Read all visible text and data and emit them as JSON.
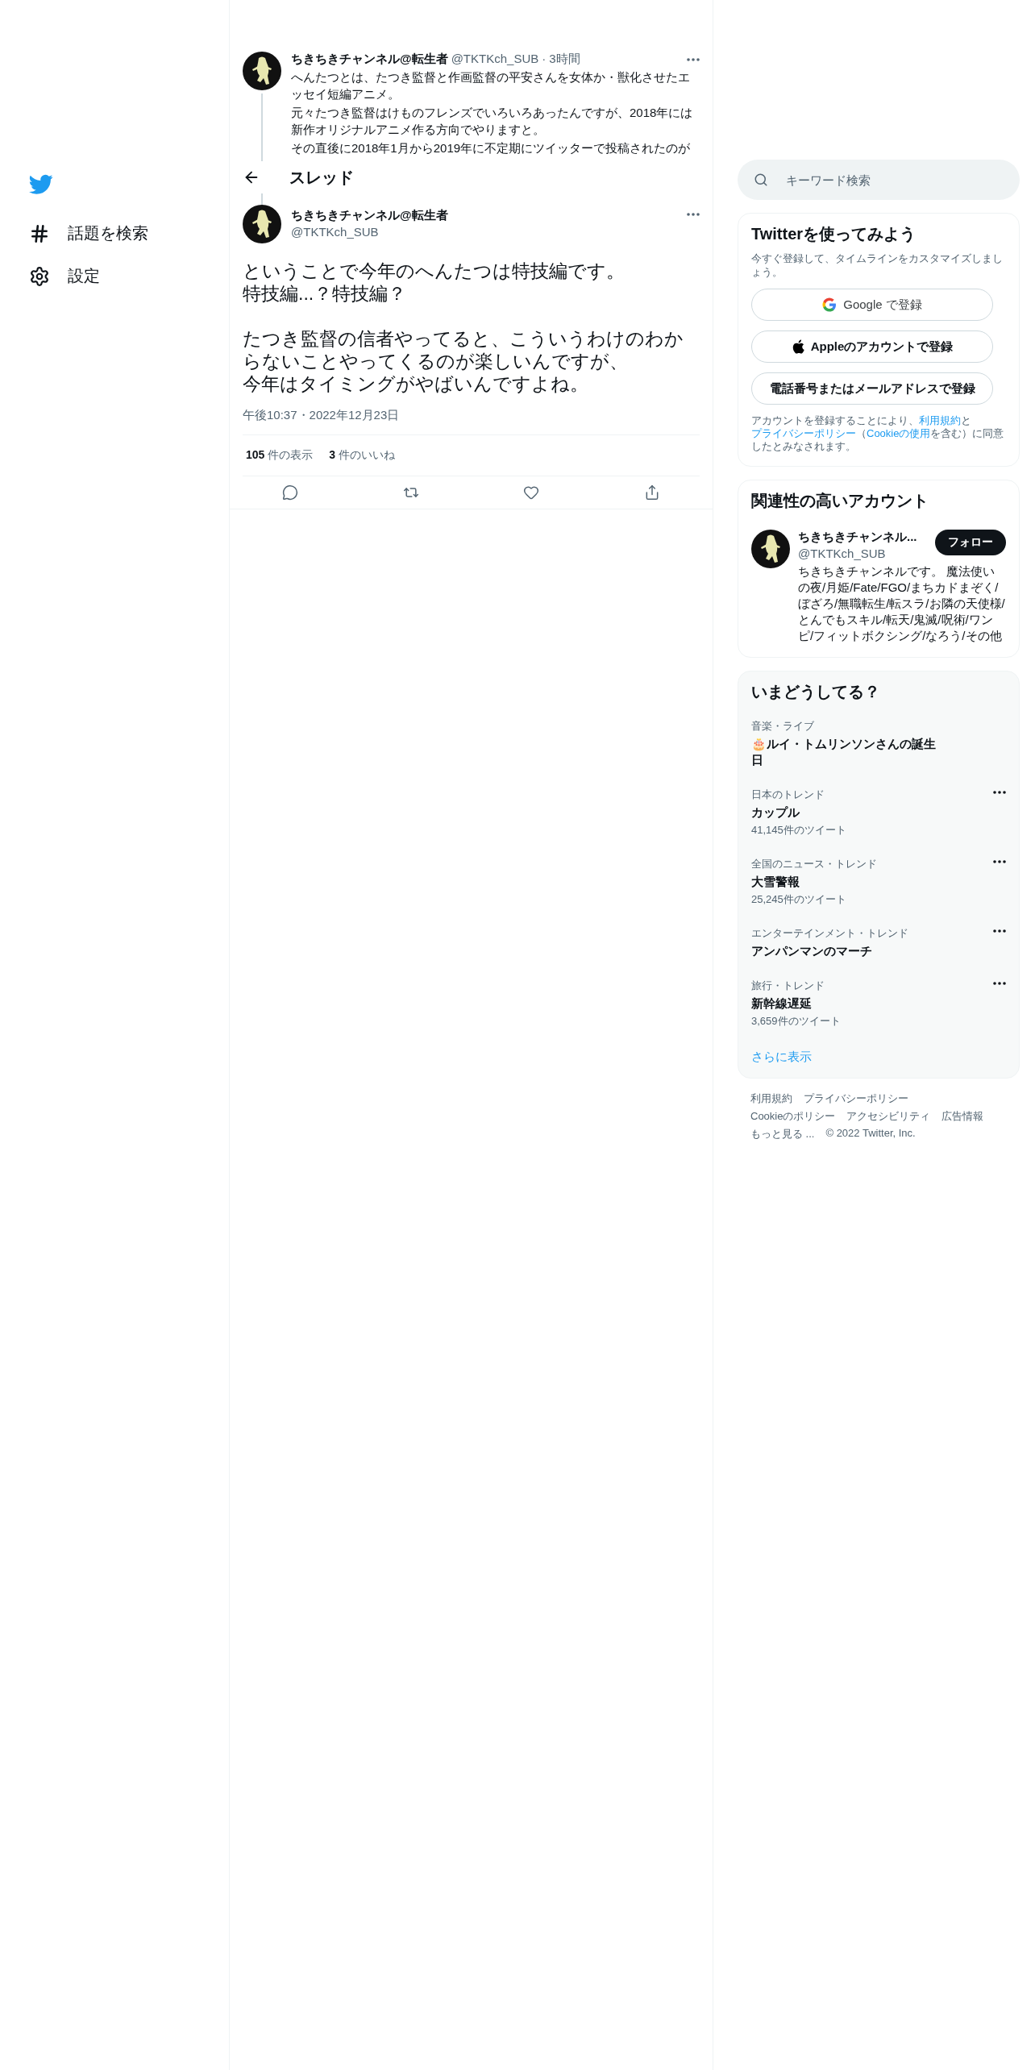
{
  "sidebar": {
    "items": [
      {
        "kind": "logo"
      },
      {
        "kind": "hashtag",
        "label": "話題を検索"
      },
      {
        "kind": "settings",
        "label": "設定"
      }
    ]
  },
  "parent_tweet": {
    "name": "ちきちきチャンネル@転生者",
    "handle": "@TKTKch_SUB",
    "dot": "·",
    "time": "3時間",
    "lines": [
      "へんたつとは、たつき監督と作画監督の平安さんを女体か・獣化させたエッセイ短編アニメ。",
      "元々たつき監督はけものフレンズでいろいろあったんですが、2018年には新作オリジナルアニメ作る方向でやりますと。",
      "その直後に2018年1月から2019年に不定期にツイッターで投稿されたのが"
    ]
  },
  "header": {
    "title": "スレッド"
  },
  "tweet": {
    "name": "ちきちきチャンネル@転生者",
    "handle": "@TKTKch_SUB",
    "paragraphs": [
      [
        "ということで今年のへんたつは特技編です。",
        "特技編...？特技編？"
      ],
      [
        "たつき監督の信者やってると、こういうわけのわからないことやってくるのが楽しいんですが、",
        "今年はタイミングがやばいんですよね。"
      ]
    ],
    "timestamp": "午後10:37・2022年12月23日",
    "stats": [
      {
        "count": "105",
        "label": "件の表示"
      },
      {
        "count": "3",
        "label": "件のいいね"
      }
    ],
    "actions": [
      {
        "kind": "reply"
      },
      {
        "kind": "retweet"
      },
      {
        "kind": "like"
      },
      {
        "kind": "share"
      }
    ]
  },
  "search": {
    "placeholder": "キーワード検索"
  },
  "signup": {
    "title": "Twitterを使ってみよう",
    "subtitle": "今すぐ登録して、タイムラインをカスタマイズしましょう。",
    "buttons": [
      {
        "kind": "google",
        "label": "Google で登録"
      },
      {
        "kind": "apple",
        "label": "Appleのアカウントで登録"
      },
      {
        "kind": "plain",
        "label": "電話番号またはメールアドレスで登録"
      }
    ],
    "legal": [
      {
        "text": "アカウントを登録することにより、",
        "link": false
      },
      {
        "text": "利用規約",
        "link": true
      },
      {
        "text": "と",
        "link": false
      },
      {
        "text": "プライバシーポリシー",
        "link": true
      },
      {
        "text": "（",
        "link": false
      },
      {
        "text": "Cookieの使用",
        "link": true
      },
      {
        "text": "を含む）に同意したとみなされます。",
        "link": false
      }
    ]
  },
  "related": {
    "title": "関連性の高いアカウント",
    "accounts": [
      {
        "name": "ちきちきチャンネル...",
        "handle": "@TKTKch_SUB",
        "button": "フォロー",
        "bio": "ちきちきチャンネルです。 魔法使いの夜/月姫/Fate/FGO/まちカドまぞく/ぼざろ/無職転生/転スラ/お隣の天使様/とんでもスキル/転天/鬼滅/呪術/ワンピ/フィットボクシング/なろう/その他"
      }
    ]
  },
  "trends": {
    "title": "いまどうしてる？",
    "items": [
      {
        "category": "音楽・ライブ",
        "title": "🎂ルイ・トムリンソンさんの誕生日",
        "menu": false
      },
      {
        "category": "日本のトレンド",
        "title": "カップル",
        "count": "41,145件のツイート",
        "menu": true
      },
      {
        "category": "全国のニュース・トレンド",
        "title": "大雪警報",
        "count": "25,245件のツイート",
        "menu": true
      },
      {
        "category": "エンターテインメント・トレンド",
        "title": "アンパンマンのマーチ",
        "menu": true
      },
      {
        "category": "旅行・トレンド",
        "title": "新幹線遅延",
        "count": "3,659件のツイート",
        "menu": true
      }
    ],
    "show_more": "さらに表示"
  },
  "footer": {
    "rows": [
      [
        "利用規約",
        "プライバシーポリシー"
      ],
      [
        "Cookieのポリシー",
        "アクセシビリティ",
        "広告情報"
      ],
      [
        "もっと見る ..."
      ]
    ],
    "copyright": "© 2022 Twitter, Inc."
  }
}
